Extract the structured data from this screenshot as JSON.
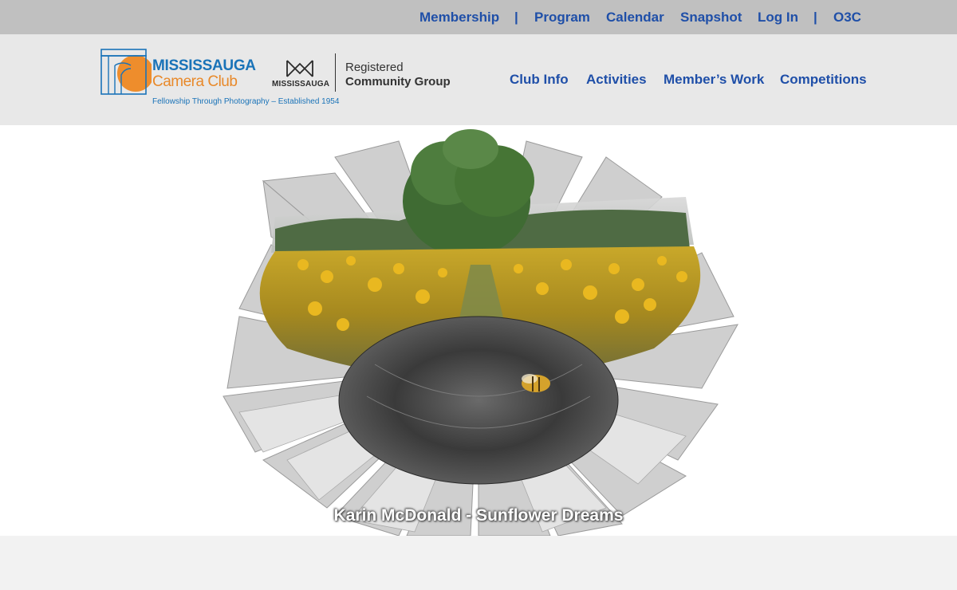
{
  "topnav": {
    "membership": "Membership",
    "sep1": "|",
    "program": "Program",
    "calendar": "Calendar",
    "snapshot": "Snapshot",
    "login": "Log In",
    "sep2": "|",
    "o3c": "O3C"
  },
  "logo": {
    "line1": "MISSISSAUGA",
    "line2": "Camera Club",
    "tagline": "Fellowship Through Photography – Established 1954"
  },
  "partner": {
    "mark_word": "MISSISSAUGA",
    "line1": "Registered",
    "line2": "Community Group"
  },
  "mainnav": {
    "club_info": "Club Info",
    "activities": "Activities",
    "members_work": "Member’s Work",
    "competitions": "Competitions"
  },
  "hero": {
    "caption": "Karin McDonald - Sunflower Dreams"
  },
  "colors": {
    "nav_blue": "#1f4fa8",
    "topbar_bg": "#c0c0c0",
    "header_bg": "#e8e8e8",
    "logo_blue": "#1a73b8",
    "logo_orange": "#e8892a"
  },
  "icons": {
    "logo_mark": "camera-outline-icon",
    "partner_mark": "mississauga-m-icon"
  }
}
